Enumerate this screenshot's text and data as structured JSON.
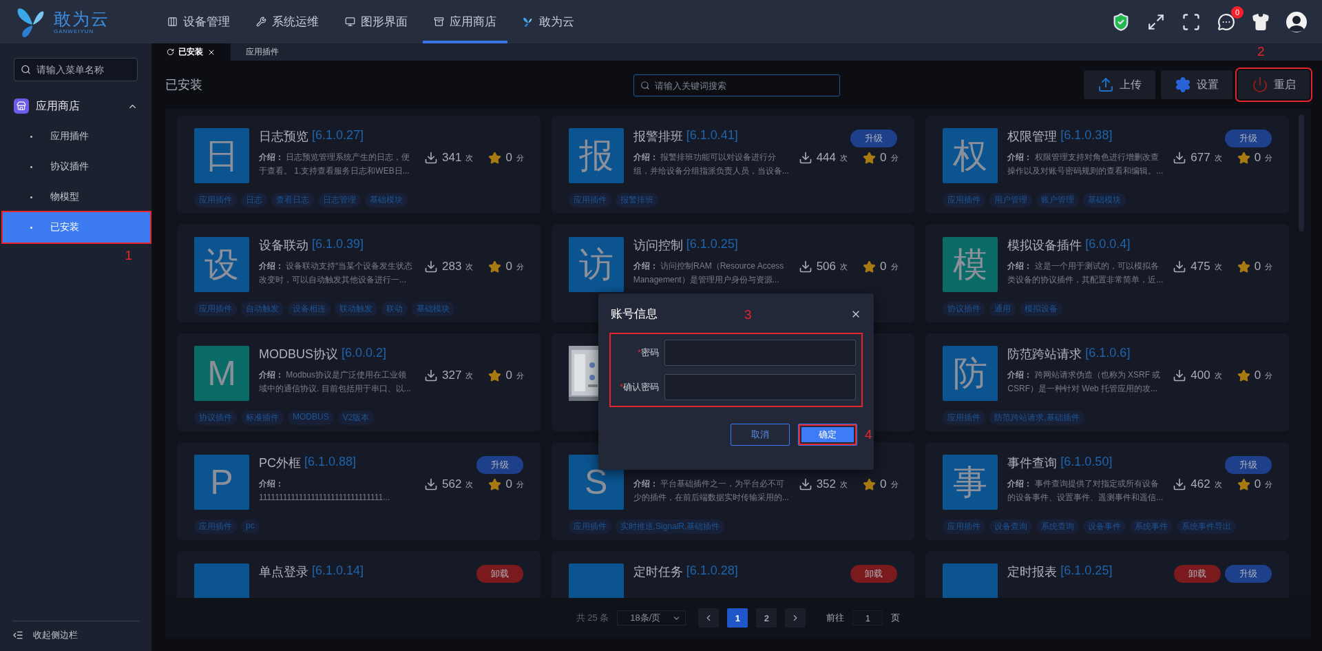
{
  "header": {
    "logo": {
      "name": "敢为云",
      "subtitle": "GANWEIYUN"
    },
    "nav": [
      {
        "label": "设备管理",
        "selected": false
      },
      {
        "label": "系统运维",
        "selected": false
      },
      {
        "label": "图形界面",
        "selected": false
      },
      {
        "label": "应用商店",
        "selected": true
      },
      {
        "label": "敢为云",
        "selected": false
      }
    ],
    "notifications": {
      "count": "0"
    }
  },
  "sidebar": {
    "search": {
      "placeholder": "请输入菜单名称"
    },
    "group": {
      "label": "应用商店",
      "expanded": true,
      "items": [
        {
          "label": "应用插件",
          "selected": false,
          "highlighted": false
        },
        {
          "label": "协议插件",
          "selected": false,
          "highlighted": false
        },
        {
          "label": "物模型",
          "selected": false,
          "highlighted": false
        },
        {
          "label": "已安装",
          "selected": true,
          "highlighted": true,
          "callout": "1"
        }
      ]
    },
    "collapse": "收起侧边栏"
  },
  "tabs": [
    {
      "label": "已安装",
      "selected": true,
      "closable": true
    },
    {
      "label": "应用插件",
      "selected": false,
      "closable": false
    }
  ],
  "toolbar": {
    "title": "已安装",
    "search": {
      "placeholder": "请输入关键词搜索"
    },
    "buttons": [
      {
        "label": "上传",
        "highlighted": false
      },
      {
        "label": "设置",
        "highlighted": false
      },
      {
        "label": "重启",
        "highlighted": true,
        "callout": "2"
      }
    ]
  },
  "cards": [
    {
      "icon": {
        "kind": "letter",
        "letter": "日",
        "color": "#0b5490"
      },
      "title": "日志预览",
      "version": "[6.1.0.27]",
      "description": "**介绍：** 日志预览管理系统产生的日志，便于查看。 1.支持查看服务日志和WEB日...",
      "downloads": "341",
      "downloads_unit": "次",
      "score": "0",
      "score_unit": "分",
      "tags": [
        "应用插件",
        "日志",
        "查看日志",
        "日志管理",
        "基础模块"
      ]
    },
    {
      "icon": {
        "kind": "letter",
        "letter": "报",
        "color": "#0b5490"
      },
      "title": "报警排班",
      "version": "[6.1.0.41]",
      "description": "**介绍：** 报警排班功能可以对设备进行分组，并给设备分组指派负责人员，当设备...",
      "downloads": "444",
      "downloads_unit": "次",
      "score": "0",
      "score_unit": "分",
      "badges": [
        {
          "label": "升级",
          "kind": "upgrade"
        }
      ],
      "tags": [
        "应用插件",
        "报警排班"
      ]
    },
    {
      "icon": {
        "kind": "letter",
        "letter": "权",
        "color": "#0b5490"
      },
      "title": "权限管理",
      "version": "[6.1.0.38]",
      "description": "**介绍：** 权限管理支持对角色进行增删改查操作以及对账号密码规则的查看和编辑。...",
      "downloads": "677",
      "downloads_unit": "次",
      "score": "0",
      "score_unit": "分",
      "badges": [
        {
          "label": "升级",
          "kind": "upgrade"
        }
      ],
      "tags": [
        "应用插件",
        "用户管理",
        "账户管理",
        "基础模块"
      ]
    },
    {
      "icon": {
        "kind": "letter",
        "letter": "设",
        "color": "#0b5490"
      },
      "title": "设备联动",
      "version": "[6.1.0.39]",
      "description": "**介绍：** 设备联动支持“当某个设备发生状态改变时，可以自动触发其他设备进行一...",
      "downloads": "283",
      "downloads_unit": "次",
      "score": "0",
      "score_unit": "分",
      "tags": [
        "应用插件",
        "自动触发",
        "设备相连",
        "联动触发",
        "联动",
        "基础模块"
      ]
    },
    {
      "icon": {
        "kind": "letter",
        "letter": "访",
        "color": "#0b5490"
      },
      "title": "访问控制",
      "version": "[6.1.0.25]",
      "description": "**介绍：** 访问控制RAM（Resource Access Management）是管理用户身份与资源...",
      "downloads": "506",
      "downloads_unit": "次",
      "score": "0",
      "score_unit": "分"
    },
    {
      "icon": {
        "kind": "letter",
        "letter": "模",
        "color": "#0b6b66"
      },
      "title": "模拟设备插件",
      "version": "[6.0.0.4]",
      "description": "**介绍：** 这是一个用于测试的，可以模拟各类设备的协议插件，其配置非常简单，近...",
      "downloads": "475",
      "downloads_unit": "次",
      "score": "0",
      "score_unit": "分",
      "tags": [
        "协议插件",
        "通用",
        "模拟设备"
      ]
    },
    {
      "icon": {
        "kind": "letter",
        "letter": "M",
        "color": "#0b6b66"
      },
      "title": "MODBUS协议",
      "version": "[6.0.0.2]",
      "description": "**介绍：** Modbus协议是广泛使用在工业领域中的通信协议. 目前包括用于串口、以...",
      "downloads": "327",
      "downloads_unit": "次",
      "score": "0",
      "score_unit": "分",
      "tags": [
        "协议插件",
        "标准插件",
        "MODBUS",
        "V2版本"
      ]
    },
    {
      "icon": {
        "kind": "picture"
      }
    },
    {
      "icon": {
        "kind": "letter",
        "letter": "防",
        "color": "#0b5490"
      },
      "title": "防范跨站请求",
      "version": "[6.1.0.6]",
      "description": "**介绍：** 跨网站请求伪造（也称为 XSRF 或 CSRF）是一种针对 Web 托管应用的攻...",
      "downloads": "400",
      "downloads_unit": "次",
      "score": "0",
      "score_unit": "分",
      "tags": [
        "应用插件",
        "防范跨站请求,基础插件"
      ]
    },
    {
      "icon": {
        "kind": "letter",
        "letter": "P",
        "color": "#0b5490"
      },
      "title": "PC外框",
      "version": "[6.1.0.88]",
      "description": "**介绍：** 1111111111111111111111111111111...",
      "downloads": "562",
      "downloads_unit": "次",
      "score": "0",
      "score_unit": "分",
      "badges": [
        {
          "label": "升级",
          "kind": "upgrade"
        }
      ],
      "tags": [
        "应用插件",
        "pc"
      ]
    },
    {
      "icon": {
        "kind": "letter",
        "letter": "S",
        "color": "#0b5490"
      },
      "description": "**介绍：** 平台基础插件之一，为平台必不可少的插件，在前后端数据实时传输采用的...",
      "downloads": "352",
      "downloads_unit": "次",
      "score": "0",
      "score_unit": "分",
      "tags": [
        "应用插件",
        "实时推送,SignalR,基础插件"
      ]
    },
    {
      "icon": {
        "kind": "letter",
        "letter": "事",
        "color": "#0b5490"
      },
      "title": "事件查询",
      "version": "[6.1.0.50]",
      "description": "**介绍：** 事件查询提供了对指定或所有设备的设备事件、设置事件、遥测事件和遥信...",
      "downloads": "462",
      "downloads_unit": "次",
      "score": "0",
      "score_unit": "分",
      "badges": [
        {
          "label": "升级",
          "kind": "upgrade"
        }
      ],
      "tags": [
        "应用插件",
        "设备查询",
        "系统查询",
        "设备事件",
        "系统事件",
        "系统事件导出"
      ]
    },
    {
      "icon": {
        "kind": "letter",
        "color": "#0b5490"
      },
      "title": "单点登录",
      "version": "[6.1.0.14]",
      "badges": [
        {
          "label": "卸载",
          "kind": "uninstall"
        }
      ]
    },
    {
      "icon": {
        "kind": "letter",
        "color": "#0b5490"
      },
      "title": "定时任务",
      "version": "[6.1.0.28]",
      "badges": [
        {
          "label": "卸载",
          "kind": "uninstall"
        }
      ]
    },
    {
      "icon": {
        "kind": "letter",
        "color": "#0b5490"
      },
      "title": "定时报表",
      "version": "[6.1.0.25]",
      "badges": [
        {
          "label": "卸载",
          "kind": "uninstall"
        },
        {
          "label": "升级",
          "kind": "upgrade"
        }
      ]
    }
  ],
  "pagination": {
    "total": "共 25 条",
    "page_size": "18条/页",
    "pages": [
      {
        "label": "1",
        "selected": true
      },
      {
        "label": "2",
        "selected": false
      }
    ],
    "goto_label": "前往",
    "goto_value": "1",
    "goto_suffix": "页"
  },
  "dialog": {
    "title": "账号信息",
    "callout": "3",
    "form_highlighted": true,
    "fields": [
      {
        "required_mark": "*",
        "label": "密码"
      },
      {
        "required_mark": "*",
        "label": "确认密码"
      }
    ],
    "buttons": [
      {
        "label": "取消",
        "kind": "secondary",
        "highlighted": false
      },
      {
        "label": "确定",
        "kind": "primary",
        "highlighted": true,
        "callout": "4"
      }
    ]
  }
}
